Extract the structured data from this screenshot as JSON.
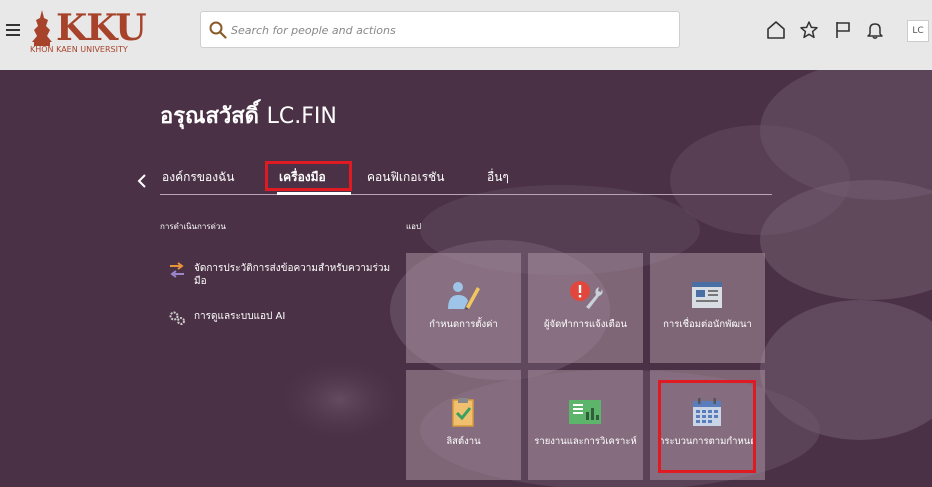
{
  "header": {
    "logo_text": "KKU",
    "logo_sub": "KHON KAEN UNIVERSITY",
    "search_placeholder": "Search for people and actions",
    "avatar": "LC"
  },
  "greeting": {
    "prefix": "อรุณสวัสดิ์",
    "name": "LC.FIN"
  },
  "tabs": [
    {
      "label": "องค์กรของฉัน"
    },
    {
      "label": "เครื่องมือ"
    },
    {
      "label": "คอนฟิเกอเรชัน"
    },
    {
      "label": "อื่นๆ"
    }
  ],
  "quick_actions": {
    "label": "การดำเนินการด่วน",
    "items": [
      {
        "label": "จัดการประวัติการส่งข้อความสำหรับความร่วมมือ"
      },
      {
        "label": "การดูแลระบบแอป AI"
      }
    ]
  },
  "apps": {
    "label": "แอป",
    "tiles": [
      {
        "label": "กำหนดการตั้งค่า",
        "icon": "person-pencil-icon"
      },
      {
        "label": "ผู้จัดทำการแจ้งเตือน",
        "icon": "alert-wrench-icon"
      },
      {
        "label": "การเชื่อมต่อนักพัฒนา",
        "icon": "developer-window-icon"
      },
      {
        "label": "ลิสต์งาน",
        "icon": "clipboard-check-icon"
      },
      {
        "label": "รายงานและการวิเคราะห์",
        "icon": "report-chart-icon"
      },
      {
        "label": "กระบวนการตามกำหนด",
        "icon": "calendar-icon"
      }
    ]
  },
  "colors": {
    "accent_red": "#e01a22",
    "brand": "#a8432b",
    "background": "#4a3145"
  }
}
